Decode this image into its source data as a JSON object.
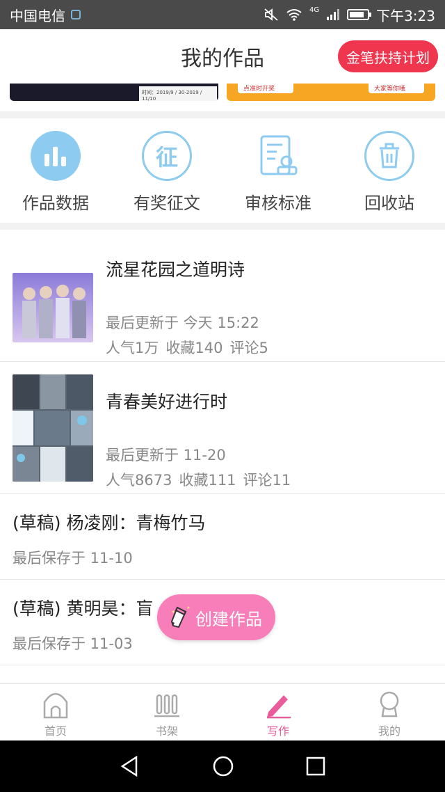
{
  "status_bar": {
    "carrier": "中国电信",
    "time": "下午3:23",
    "network": "4G"
  },
  "header": {
    "title": "我的作品",
    "promo_button": "金笔扶持计划"
  },
  "banners": {
    "left_sub": "时间：2019/9 / 30-2019 / 11/10",
    "right_tag_left": "点准时开奖",
    "right_tag_right": "大家等你哦"
  },
  "actions": [
    {
      "label": "作品数据",
      "icon": "bar-chart-icon"
    },
    {
      "label": "有奖征文",
      "icon": "essay-icon",
      "glyph": "征"
    },
    {
      "label": "审核标准",
      "icon": "review-doc-icon"
    },
    {
      "label": "回收站",
      "icon": "trash-icon"
    }
  ],
  "works": [
    {
      "title": "流星花园之道明诗",
      "updated": "最后更新于 今天 15:22",
      "popularity": "人气1万",
      "favorites": "收藏140",
      "comments": "评论5"
    },
    {
      "title": "青春美好进行时",
      "updated": "最后更新于 11-20",
      "popularity": "人气8673",
      "favorites": "收藏111",
      "comments": "评论11"
    }
  ],
  "drafts": [
    {
      "title": "(草稿) 杨凌刚：青梅竹马",
      "saved": "最后保存于 11-10"
    },
    {
      "title": "(草稿) 黄明昊：盲",
      "saved": "最后保存于 11-03"
    }
  ],
  "fab": {
    "label": "创建作品"
  },
  "tabs": [
    {
      "label": "首页",
      "icon": "home-icon"
    },
    {
      "label": "书架",
      "icon": "bookshelf-icon"
    },
    {
      "label": "写作",
      "icon": "pen-icon"
    },
    {
      "label": "我的",
      "icon": "profile-icon"
    }
  ],
  "colors": {
    "accent_pink": "#e85d9a",
    "promo_red": "#f0364e",
    "icon_blue": "#8ecbf0"
  }
}
